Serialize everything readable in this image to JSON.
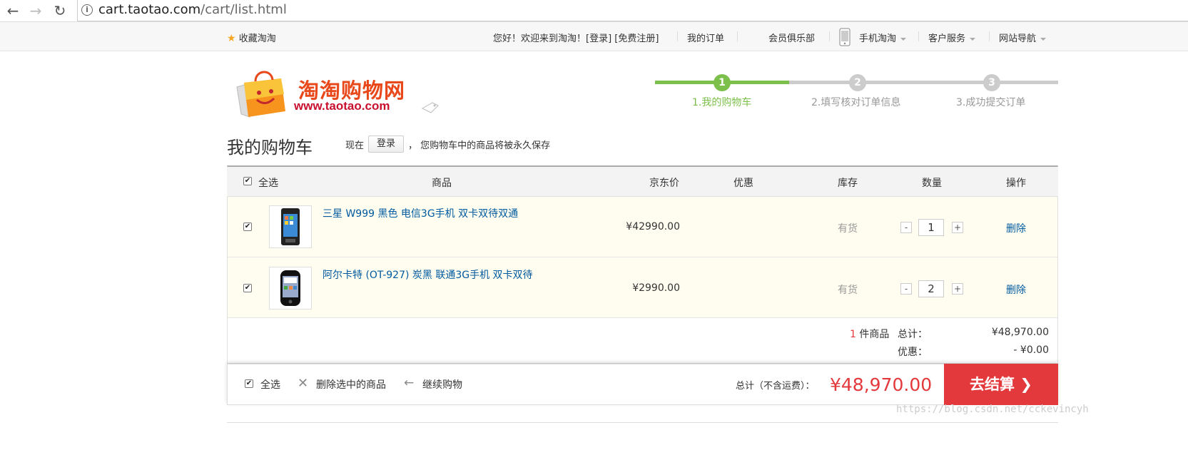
{
  "browser": {
    "url_host": "cart.taotao.com",
    "url_path": "/cart/list.html"
  },
  "topnav": {
    "favorite": "收藏淘淘",
    "greeting": "您好！欢迎来到淘淘！[登录] [免费注册]",
    "my_orders": "我的订单",
    "member_club": "会员俱乐部",
    "mobile": "手机淘淘",
    "service": "客户服务",
    "site_nav": "网站导航"
  },
  "logo": {
    "title": "淘淘购物网",
    "url": "www.taotao.com"
  },
  "steps": [
    {
      "num": "1",
      "label": "1.我的购物车",
      "active": true
    },
    {
      "num": "2",
      "label": "2.填写核对订单信息",
      "active": false
    },
    {
      "num": "3",
      "label": "3.成功提交订单",
      "active": false
    }
  ],
  "cart": {
    "title": "我的购物车",
    "note_prefix": "现在",
    "login_label": "登录",
    "note_suffix": "，  您购物车中的商品将被永久保存"
  },
  "table": {
    "headers": {
      "select_all": "全选",
      "product": "商品",
      "price": "京东价",
      "discount": "优惠",
      "stock": "库存",
      "quantity": "数量",
      "action": "操作"
    },
    "rows": [
      {
        "name": "三星 W999 黑色 电信3G手机 双卡双待双通",
        "price": "¥42990.00",
        "stock": "有货",
        "qty": "1",
        "action": "删除",
        "checked": true
      },
      {
        "name": "阿尔卡特 (OT-927) 炭黑 联通3G手机 双卡双待",
        "price": "¥2990.00",
        "stock": "有货",
        "qty": "2",
        "action": "删除",
        "checked": true
      }
    ],
    "qty_minus": "-",
    "qty_plus": "+"
  },
  "summary": {
    "count": "1",
    "count_suffix": "件商品",
    "total_label": "总计：",
    "total_value": "¥48,970.00",
    "discount_label": "优惠：",
    "discount_value": "- ¥0.00"
  },
  "footer": {
    "select_all": "全选",
    "delete_selected": "删除选中的商品",
    "continue_shopping": "继续购物",
    "total_label": "总计（不含运费）：",
    "total_value": "¥48,970.00",
    "checkout": "去结算"
  },
  "watermark": "https://blog.csdn.net/cckevincyh",
  "colors": {
    "accent_red": "#e4393c",
    "step_green": "#7cc04b",
    "link_blue": "#005aa0"
  }
}
